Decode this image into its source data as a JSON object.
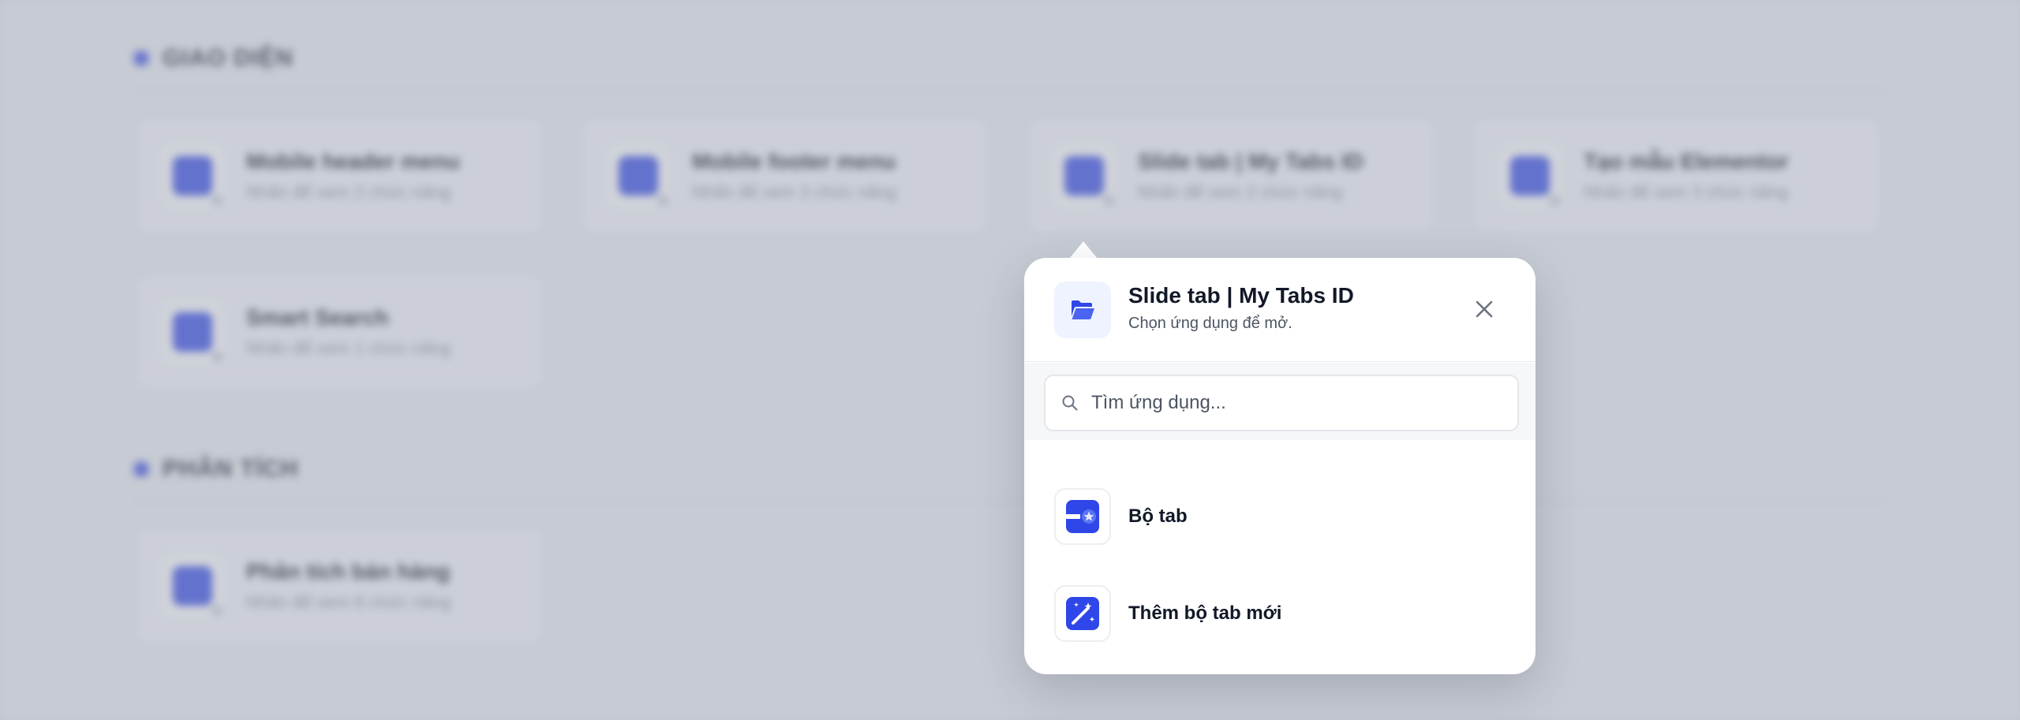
{
  "background": {
    "sections": [
      {
        "title": "GIAO DIỆN",
        "cards": [
          {
            "title": "Mobile header menu",
            "subtitle": "Nhấn để xem 2 chức năng",
            "icon": "mobile-header-icon"
          },
          {
            "title": "Mobile footer menu",
            "subtitle": "Nhấn để xem 3 chức năng",
            "icon": "mobile-footer-icon"
          },
          {
            "title": "Slide tab | My Tabs ID",
            "subtitle": "Nhấn để xem 2 chức năng",
            "icon": "slide-tab-icon"
          },
          {
            "title": "Tạo mẫu Elementor",
            "subtitle": "Nhấn để xem 3 chức năng",
            "icon": "elementor-icon"
          },
          {
            "title": "Smart Search",
            "subtitle": "Nhấn để xem 1 chức năng",
            "icon": "smart-search-icon"
          }
        ]
      },
      {
        "title": "PHÂN TÍCH",
        "cards": [
          {
            "title": "Phân tích bán hàng",
            "subtitle": "Nhấn để xem 8 chức năng",
            "icon": "sales-analytics-icon"
          }
        ]
      }
    ]
  },
  "popup": {
    "title": "Slide tab | My Tabs ID",
    "subtitle": "Chọn ứng dụng để mở.",
    "header_icon": "folder-open-icon",
    "close_icon": "close-icon",
    "search": {
      "placeholder": "Tìm ứng dụng...",
      "value": "",
      "icon": "search-icon"
    },
    "items": [
      {
        "label": "Bộ tab",
        "icon": "tab-set-icon"
      },
      {
        "label": "Thêm bộ tab mới",
        "icon": "magic-wand-icon"
      }
    ]
  },
  "colors": {
    "accent": "#2f46e8",
    "overlay": "#969eac",
    "title_text": "#111827"
  }
}
